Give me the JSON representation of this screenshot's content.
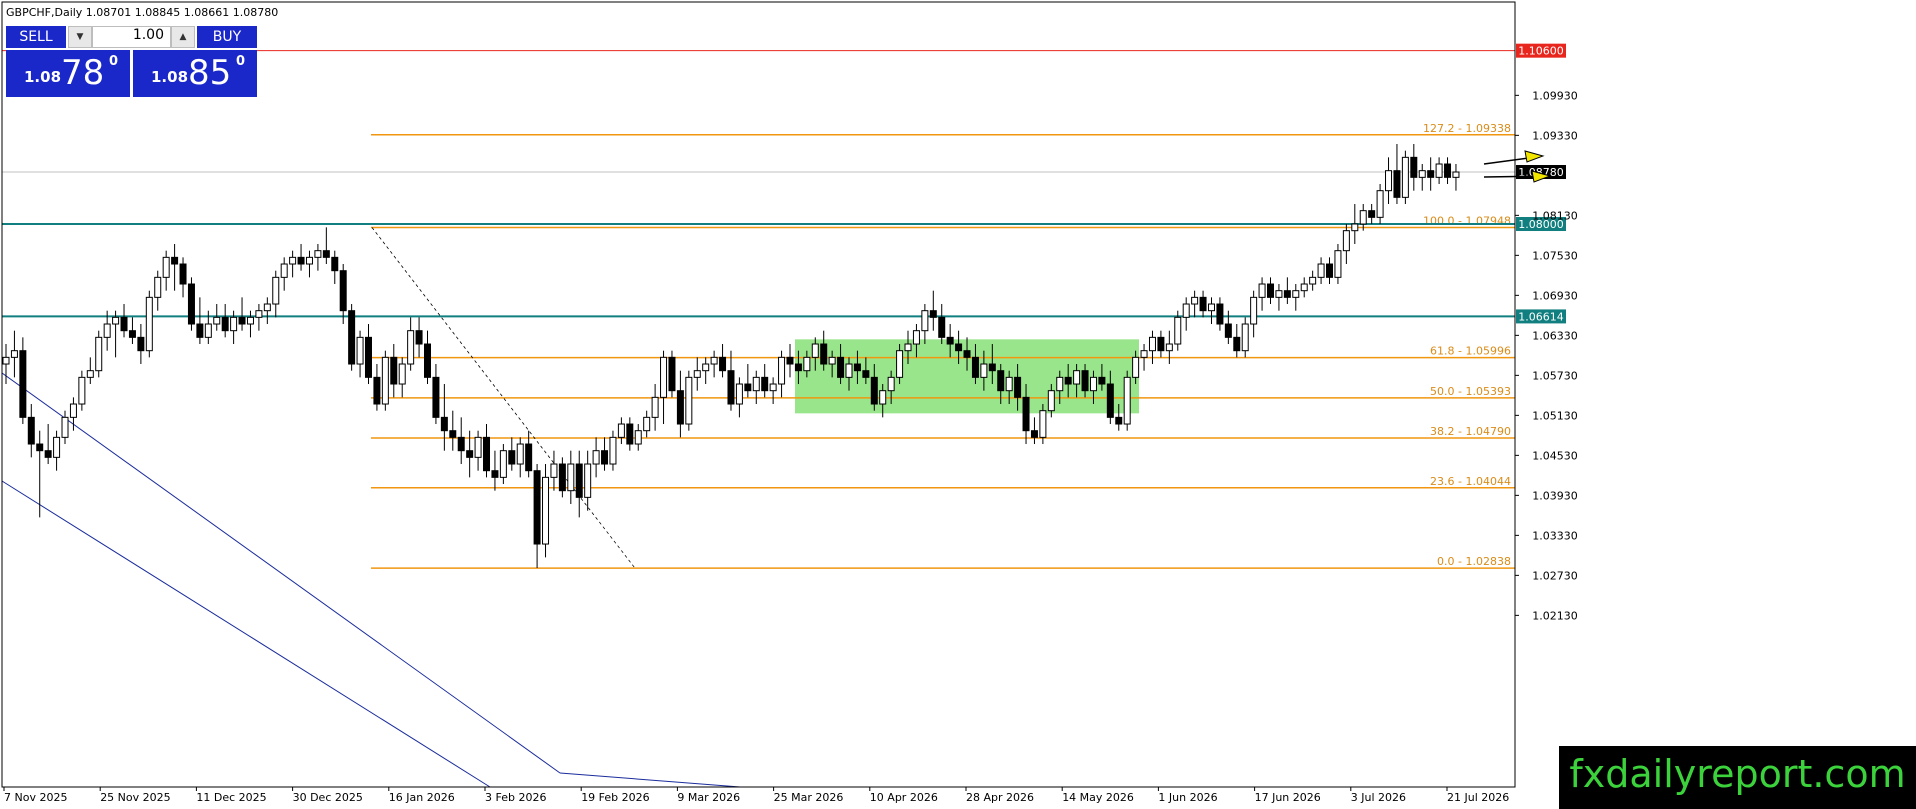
{
  "header": {
    "symbol_info": "GBPCHF,Daily  1.08701 1.08845 1.08661 1.08780"
  },
  "trade_panel": {
    "sell_label": "SELL",
    "buy_label": "BUY",
    "lot": "1.00",
    "sell_small": "1.08",
    "sell_big": "78",
    "sell_sup": "0",
    "buy_small": "1.08",
    "buy_big": "85",
    "buy_sup": "0",
    "button_color": "#1a27c9"
  },
  "watermark": {
    "text": "fxdailyreport.com",
    "color": "#3cd23c"
  },
  "colors": {
    "fib": "#f0960f",
    "support": "#117f7f",
    "resistance_red": "#e8261e",
    "channel": "#1a2c9c",
    "zone": "#8ee27e",
    "arrow": "#f2e600"
  },
  "chart_data": {
    "type": "candlestick",
    "symbol": "GBPCHF",
    "timeframe": "Daily",
    "ylim": [
      1.015,
      1.1136
    ],
    "y_ticks": [
      "1.09930",
      "1.09330",
      "1.08130",
      "1.07530",
      "1.06930",
      "1.06330",
      "1.05730",
      "1.05130",
      "1.04530",
      "1.03930",
      "1.03330",
      "1.02730",
      "1.02130"
    ],
    "x_labels": [
      "7 Nov 2025",
      "25 Nov 2025",
      "11 Dec 2025",
      "30 Dec 2025",
      "16 Jan 2026",
      "3 Feb 2026",
      "19 Feb 2026",
      "9 Mar 2026",
      "25 Mar 2026",
      "10 Apr 2026",
      "28 Apr 2026",
      "14 May 2026",
      "1 Jun 2026",
      "17 Jun 2026",
      "3 Jul 2026",
      "21 Jul 2026"
    ],
    "current_price": "1.08780",
    "horizontal_levels": [
      {
        "label": "1.10600",
        "value": 1.106,
        "style": "red"
      },
      {
        "label": "1.08000",
        "value": 1.08,
        "style": "support"
      },
      {
        "label": "1.06614",
        "value": 1.06614,
        "style": "support"
      }
    ],
    "fibonacci": [
      {
        "label": "127.2 - 1.09338",
        "value": 1.09338
      },
      {
        "label": "100.0 - 1.07948",
        "value": 1.07948
      },
      {
        "label": "61.8 - 1.05996",
        "value": 1.05996
      },
      {
        "label": "50.0 - 1.05393",
        "value": 1.05393
      },
      {
        "label": "38.2 - 1.04790",
        "value": 1.0479
      },
      {
        "label": "23.6 - 1.04044",
        "value": 1.04044
      },
      {
        "label": "0.0 - 1.02838",
        "value": 1.02838
      }
    ],
    "consolidation_zone": {
      "y_top": 1.0627,
      "y_bottom": 1.0516
    },
    "ohlc": [
      [
        1.059,
        1.062,
        1.056,
        1.06
      ],
      [
        1.06,
        1.064,
        1.057,
        1.061
      ],
      [
        1.061,
        1.063,
        1.05,
        1.051
      ],
      [
        1.051,
        1.053,
        1.045,
        1.047
      ],
      [
        1.047,
        1.049,
        1.036,
        1.046
      ],
      [
        1.046,
        1.05,
        1.044,
        1.045
      ],
      [
        1.045,
        1.049,
        1.043,
        1.048
      ],
      [
        1.048,
        1.052,
        1.047,
        1.051
      ],
      [
        1.051,
        1.054,
        1.049,
        1.053
      ],
      [
        1.053,
        1.058,
        1.052,
        1.057
      ],
      [
        1.057,
        1.06,
        1.056,
        1.058
      ],
      [
        1.058,
        1.064,
        1.057,
        1.063
      ],
      [
        1.063,
        1.067,
        1.061,
        1.065
      ],
      [
        1.065,
        1.067,
        1.06,
        1.066
      ],
      [
        1.066,
        1.068,
        1.063,
        1.064
      ],
      [
        1.064,
        1.066,
        1.062,
        1.063
      ],
      [
        1.063,
        1.065,
        1.059,
        1.061
      ],
      [
        1.061,
        1.07,
        1.06,
        1.069
      ],
      [
        1.069,
        1.073,
        1.067,
        1.072
      ],
      [
        1.072,
        1.076,
        1.07,
        1.075
      ],
      [
        1.075,
        1.077,
        1.07,
        1.074
      ],
      [
        1.074,
        1.075,
        1.069,
        1.071
      ],
      [
        1.071,
        1.072,
        1.064,
        1.065
      ],
      [
        1.065,
        1.069,
        1.062,
        1.063
      ],
      [
        1.063,
        1.067,
        1.062,
        1.065
      ],
      [
        1.065,
        1.068,
        1.064,
        1.066
      ],
      [
        1.066,
        1.068,
        1.063,
        1.064
      ],
      [
        1.064,
        1.067,
        1.062,
        1.066
      ],
      [
        1.066,
        1.069,
        1.064,
        1.065
      ],
      [
        1.065,
        1.067,
        1.063,
        1.066
      ],
      [
        1.066,
        1.068,
        1.064,
        1.067
      ],
      [
        1.067,
        1.069,
        1.065,
        1.068
      ],
      [
        1.068,
        1.073,
        1.066,
        1.072
      ],
      [
        1.072,
        1.075,
        1.07,
        1.074
      ],
      [
        1.074,
        1.076,
        1.072,
        1.075
      ],
      [
        1.075,
        1.077,
        1.073,
        1.074
      ],
      [
        1.074,
        1.076,
        1.072,
        1.075
      ],
      [
        1.075,
        1.077,
        1.073,
        1.076
      ],
      [
        1.076,
        1.0795,
        1.074,
        1.075
      ],
      [
        1.075,
        1.076,
        1.071,
        1.073
      ],
      [
        1.073,
        1.074,
        1.065,
        1.067
      ],
      [
        1.067,
        1.068,
        1.058,
        1.059
      ],
      [
        1.059,
        1.064,
        1.057,
        1.063
      ],
      [
        1.063,
        1.065,
        1.056,
        1.057
      ],
      [
        1.057,
        1.059,
        1.052,
        1.053
      ],
      [
        1.053,
        1.061,
        1.052,
        1.06
      ],
      [
        1.06,
        1.062,
        1.054,
        1.056
      ],
      [
        1.056,
        1.06,
        1.054,
        1.059
      ],
      [
        1.059,
        1.066,
        1.058,
        1.064
      ],
      [
        1.064,
        1.066,
        1.06,
        1.062
      ],
      [
        1.062,
        1.064,
        1.056,
        1.057
      ],
      [
        1.057,
        1.059,
        1.05,
        1.051
      ],
      [
        1.051,
        1.056,
        1.046,
        1.049
      ],
      [
        1.049,
        1.052,
        1.046,
        1.048
      ],
      [
        1.048,
        1.051,
        1.044,
        1.046
      ],
      [
        1.046,
        1.049,
        1.042,
        1.045
      ],
      [
        1.045,
        1.049,
        1.043,
        1.048
      ],
      [
        1.048,
        1.05,
        1.042,
        1.043
      ],
      [
        1.043,
        1.046,
        1.04,
        1.042
      ],
      [
        1.042,
        1.047,
        1.041,
        1.046
      ],
      [
        1.046,
        1.048,
        1.043,
        1.044
      ],
      [
        1.044,
        1.048,
        1.042,
        1.047
      ],
      [
        1.047,
        1.049,
        1.042,
        1.043
      ],
      [
        1.043,
        1.044,
        1.0284,
        1.032
      ],
      [
        1.032,
        1.044,
        1.03,
        1.042
      ],
      [
        1.042,
        1.046,
        1.04,
        1.044
      ],
      [
        1.044,
        1.045,
        1.039,
        1.04
      ],
      [
        1.04,
        1.046,
        1.038,
        1.044
      ],
      [
        1.044,
        1.046,
        1.036,
        1.039
      ],
      [
        1.039,
        1.046,
        1.037,
        1.044
      ],
      [
        1.044,
        1.048,
        1.042,
        1.046
      ],
      [
        1.046,
        1.048,
        1.043,
        1.044
      ],
      [
        1.044,
        1.049,
        1.043,
        1.048
      ],
      [
        1.048,
        1.051,
        1.047,
        1.05
      ],
      [
        1.05,
        1.051,
        1.046,
        1.047
      ],
      [
        1.047,
        1.05,
        1.046,
        1.049
      ],
      [
        1.049,
        1.052,
        1.048,
        1.051
      ],
      [
        1.051,
        1.056,
        1.049,
        1.054
      ],
      [
        1.054,
        1.061,
        1.05,
        1.06
      ],
      [
        1.06,
        1.061,
        1.054,
        1.055
      ],
      [
        1.055,
        1.058,
        1.048,
        1.05
      ],
      [
        1.05,
        1.058,
        1.049,
        1.057
      ],
      [
        1.057,
        1.06,
        1.055,
        1.058
      ],
      [
        1.058,
        1.06,
        1.056,
        1.059
      ],
      [
        1.059,
        1.061,
        1.057,
        1.06
      ],
      [
        1.06,
        1.062,
        1.057,
        1.058
      ],
      [
        1.058,
        1.061,
        1.052,
        1.053
      ],
      [
        1.053,
        1.057,
        1.051,
        1.056
      ],
      [
        1.056,
        1.059,
        1.054,
        1.055
      ],
      [
        1.055,
        1.058,
        1.053,
        1.057
      ],
      [
        1.057,
        1.059,
        1.054,
        1.055
      ],
      [
        1.055,
        1.057,
        1.053,
        1.056
      ],
      [
        1.056,
        1.061,
        1.054,
        1.06
      ],
      [
        1.06,
        1.062,
        1.057,
        1.059
      ],
      [
        1.059,
        1.061,
        1.056,
        1.058
      ],
      [
        1.058,
        1.061,
        1.057,
        1.06
      ],
      [
        1.06,
        1.063,
        1.058,
        1.062
      ],
      [
        1.062,
        1.064,
        1.058,
        1.059
      ],
      [
        1.059,
        1.061,
        1.057,
        1.06
      ],
      [
        1.06,
        1.062,
        1.056,
        1.057
      ],
      [
        1.057,
        1.06,
        1.055,
        1.059
      ],
      [
        1.059,
        1.061,
        1.056,
        1.058
      ],
      [
        1.058,
        1.06,
        1.056,
        1.057
      ],
      [
        1.057,
        1.059,
        1.052,
        1.053
      ],
      [
        1.053,
        1.056,
        1.051,
        1.055
      ],
      [
        1.055,
        1.058,
        1.053,
        1.057
      ],
      [
        1.057,
        1.062,
        1.056,
        1.061
      ],
      [
        1.061,
        1.064,
        1.059,
        1.062
      ],
      [
        1.062,
        1.065,
        1.06,
        1.064
      ],
      [
        1.064,
        1.068,
        1.062,
        1.067
      ],
      [
        1.067,
        1.07,
        1.064,
        1.066
      ],
      [
        1.066,
        1.068,
        1.062,
        1.063
      ],
      [
        1.063,
        1.065,
        1.06,
        1.062
      ],
      [
        1.062,
        1.064,
        1.059,
        1.061
      ],
      [
        1.061,
        1.063,
        1.058,
        1.06
      ],
      [
        1.06,
        1.062,
        1.056,
        1.057
      ],
      [
        1.057,
        1.061,
        1.055,
        1.059
      ],
      [
        1.059,
        1.062,
        1.056,
        1.058
      ],
      [
        1.058,
        1.059,
        1.053,
        1.055
      ],
      [
        1.055,
        1.058,
        1.053,
        1.057
      ],
      [
        1.057,
        1.059,
        1.052,
        1.054
      ],
      [
        1.054,
        1.056,
        1.047,
        1.049
      ],
      [
        1.049,
        1.051,
        1.047,
        1.048
      ],
      [
        1.048,
        1.053,
        1.047,
        1.052
      ],
      [
        1.052,
        1.056,
        1.051,
        1.055
      ],
      [
        1.055,
        1.058,
        1.053,
        1.057
      ],
      [
        1.057,
        1.059,
        1.054,
        1.056
      ],
      [
        1.056,
        1.059,
        1.054,
        1.058
      ],
      [
        1.058,
        1.059,
        1.054,
        1.055
      ],
      [
        1.055,
        1.058,
        1.053,
        1.057
      ],
      [
        1.057,
        1.059,
        1.055,
        1.056
      ],
      [
        1.056,
        1.058,
        1.05,
        1.051
      ],
      [
        1.051,
        1.053,
        1.049,
        1.05
      ],
      [
        1.05,
        1.058,
        1.049,
        1.057
      ],
      [
        1.057,
        1.061,
        1.056,
        1.06
      ],
      [
        1.06,
        1.062,
        1.058,
        1.061
      ],
      [
        1.061,
        1.064,
        1.059,
        1.063
      ],
      [
        1.063,
        1.064,
        1.06,
        1.061
      ],
      [
        1.061,
        1.064,
        1.059,
        1.062
      ],
      [
        1.062,
        1.067,
        1.061,
        1.066
      ],
      [
        1.066,
        1.069,
        1.064,
        1.068
      ],
      [
        1.068,
        1.07,
        1.066,
        1.069
      ],
      [
        1.069,
        1.07,
        1.066,
        1.067
      ],
      [
        1.067,
        1.069,
        1.065,
        1.068
      ],
      [
        1.068,
        1.069,
        1.064,
        1.065
      ],
      [
        1.065,
        1.067,
        1.062,
        1.063
      ],
      [
        1.063,
        1.065,
        1.06,
        1.061
      ],
      [
        1.061,
        1.066,
        1.06,
        1.065
      ],
      [
        1.065,
        1.07,
        1.063,
        1.069
      ],
      [
        1.069,
        1.072,
        1.067,
        1.071
      ],
      [
        1.071,
        1.072,
        1.068,
        1.069
      ],
      [
        1.069,
        1.071,
        1.067,
        1.07
      ],
      [
        1.07,
        1.072,
        1.068,
        1.069
      ],
      [
        1.069,
        1.071,
        1.067,
        1.07
      ],
      [
        1.07,
        1.072,
        1.069,
        1.071
      ],
      [
        1.071,
        1.073,
        1.07,
        1.072
      ],
      [
        1.072,
        1.075,
        1.071,
        1.074
      ],
      [
        1.074,
        1.075,
        1.071,
        1.072
      ],
      [
        1.072,
        1.077,
        1.071,
        1.076
      ],
      [
        1.076,
        1.08,
        1.074,
        1.079
      ],
      [
        1.079,
        1.083,
        1.077,
        1.08
      ],
      [
        1.08,
        1.083,
        1.079,
        1.082
      ],
      [
        1.082,
        1.083,
        1.08,
        1.081
      ],
      [
        1.081,
        1.086,
        1.08,
        1.085
      ],
      [
        1.085,
        1.09,
        1.083,
        1.088
      ],
      [
        1.088,
        1.092,
        1.083,
        1.084
      ],
      [
        1.084,
        1.091,
        1.083,
        1.09
      ],
      [
        1.09,
        1.092,
        1.085,
        1.087
      ],
      [
        1.087,
        1.089,
        1.085,
        1.088
      ],
      [
        1.088,
        1.09,
        1.085,
        1.087
      ],
      [
        1.087,
        1.09,
        1.086,
        1.089
      ],
      [
        1.089,
        1.09,
        1.086,
        1.087
      ],
      [
        1.087,
        1.089,
        1.085,
        1.0878
      ]
    ]
  }
}
